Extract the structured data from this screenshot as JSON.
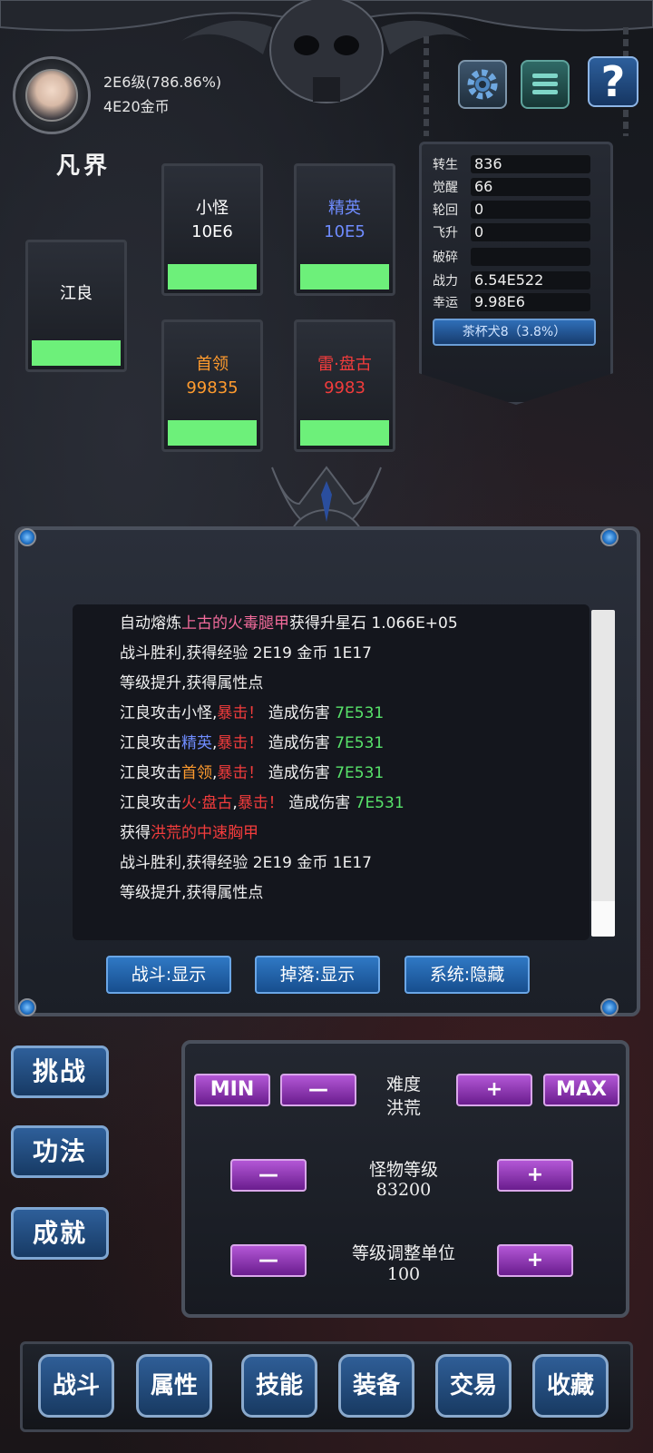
{
  "player": {
    "level": "2E6级(786.86%)",
    "gold": "4E20金币",
    "realm": "凡界"
  },
  "top_buttons": {
    "gear": "gear-icon",
    "menu": "menu-icon",
    "help": "?"
  },
  "hero_card": {
    "name": "江良"
  },
  "enemies": [
    {
      "name": "小怪",
      "value": "10E6",
      "color": "#ffffff"
    },
    {
      "name": "精英",
      "value": "10E5",
      "color": "#6f8cff"
    },
    {
      "name": "首领",
      "value": "99835",
      "color": "#ff9b2e"
    },
    {
      "name": "雷·盘古",
      "value": "9983",
      "color": "#f23c3c"
    }
  ],
  "stats": {
    "rebirth": {
      "label": "转生",
      "value": "836"
    },
    "awaken": {
      "label": "觉醒",
      "value": "66"
    },
    "reincarnation": {
      "label": "轮回",
      "value": "0"
    },
    "ascend": {
      "label": "飞升",
      "value": "0"
    },
    "shatter": {
      "label": "破碎",
      "value": ""
    },
    "power": {
      "label": "战力",
      "value": "6.54E522"
    },
    "luck": {
      "label": "幸运",
      "value": "9.98E6"
    },
    "pet": "茶杯犬8（3.8%）"
  },
  "log": {
    "l1a": "自动熔炼",
    "l1b": "上古的火毒腿甲",
    "l1c": "获得升星石 1.066E+05",
    "l2": "战斗胜利,获得经验 2E19  金币 1E17",
    "l3": "等级提升,获得属性点",
    "l4a": "江良攻击小怪,",
    "l4b": "暴击！",
    "l4c": " 造成伤害 ",
    "l4d": "7E531",
    "l5a": "江良攻击",
    "l5b": "精英",
    "l5c": ",",
    "l5d": "暴击！",
    "l5e": " 造成伤害 ",
    "l5f": "7E531",
    "l6a": "江良攻击",
    "l6b": "首领",
    "l6c": ",",
    "l6d": "暴击！",
    "l6e": " 造成伤害 ",
    "l6f": "7E531",
    "l7a": "江良攻击",
    "l7b": "火·盘古",
    "l7c": ",",
    "l7d": "暴击！",
    "l7e": " 造成伤害 ",
    "l7f": "7E531",
    "l8a": "获得",
    "l8b": "洪荒的中速胸甲",
    "l9": "战斗胜利,获得经验 2E19  金币 1E17",
    "l10": "等级提升,获得属性点"
  },
  "filters": {
    "battle": "战斗:显示",
    "drop": "掉落:显示",
    "system": "系统:隐藏"
  },
  "side_buttons": {
    "challenge": "挑战",
    "technique": "功法",
    "achievement": "成就"
  },
  "controls": {
    "min": "MIN",
    "max": "MAX",
    "minus": "—",
    "plus": "+",
    "difficulty_label": "难度",
    "difficulty_value": "洪荒",
    "monster_level_label": "怪物等级",
    "monster_level_value": "83200",
    "step_label": "等级调整单位",
    "step_value": "100"
  },
  "nav": {
    "battle": "战斗",
    "attributes": "属性",
    "skills": "技能",
    "equipment": "装备",
    "trade": "交易",
    "collection": "收藏"
  }
}
